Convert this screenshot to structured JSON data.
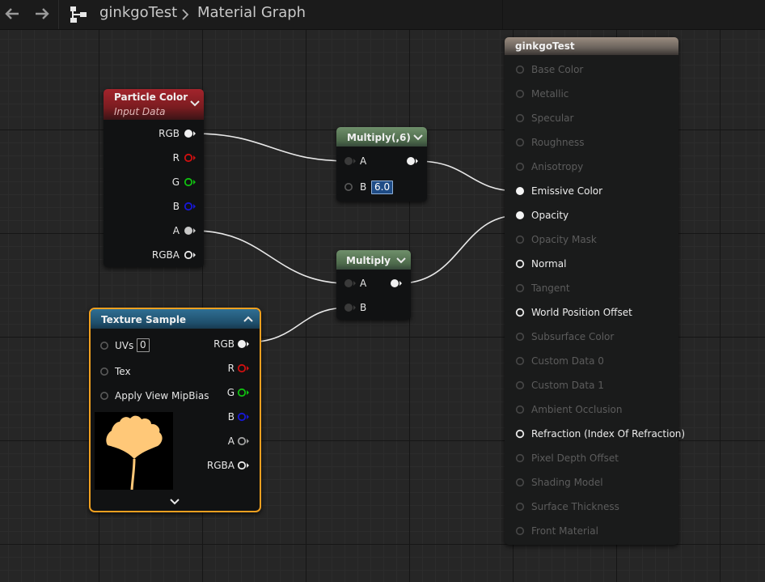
{
  "toolbar": {
    "back_icon": "arrow-left-icon",
    "forward_icon": "arrow-right-icon",
    "hierarchy_icon": "hierarchy-icon",
    "breadcrumb": [
      "ginkgoTest",
      "Material Graph"
    ]
  },
  "nodes": {
    "particle_color": {
      "title": "Particle Color",
      "subtitle": "Input Data",
      "pins": [
        "RGB",
        "R",
        "G",
        "B",
        "A",
        "RGBA"
      ]
    },
    "multiply6": {
      "title": "Multiply(,6)",
      "pin_a": "A",
      "pin_b": "B",
      "b_value": "6.0"
    },
    "multiply": {
      "title": "Multiply",
      "pin_a": "A",
      "pin_b": "B"
    },
    "texture_sample": {
      "title": "Texture Sample",
      "inputs": [
        "UVs",
        "Tex",
        "Apply View MipBias"
      ],
      "uvs_value": "0",
      "outputs": [
        "RGB",
        "R",
        "G",
        "B",
        "A",
        "RGBA"
      ]
    },
    "result": {
      "title": "ginkgoTest",
      "pins": [
        {
          "label": "Base Color",
          "active": false
        },
        {
          "label": "Metallic",
          "active": false
        },
        {
          "label": "Specular",
          "active": false
        },
        {
          "label": "Roughness",
          "active": false
        },
        {
          "label": "Anisotropy",
          "active": false
        },
        {
          "label": "Emissive Color",
          "active": true,
          "connected": true
        },
        {
          "label": "Opacity",
          "active": true,
          "connected": true
        },
        {
          "label": "Opacity Mask",
          "active": false
        },
        {
          "label": "Normal",
          "active": true,
          "connected": false
        },
        {
          "label": "Tangent",
          "active": false
        },
        {
          "label": "World Position Offset",
          "active": true,
          "connected": false
        },
        {
          "label": "Subsurface Color",
          "active": false
        },
        {
          "label": "Custom Data 0",
          "active": false
        },
        {
          "label": "Custom Data 1",
          "active": false
        },
        {
          "label": "Ambient Occlusion",
          "active": false
        },
        {
          "label": "Refraction (Index Of Refraction)",
          "active": true,
          "connected": false
        },
        {
          "label": "Pixel Depth Offset",
          "active": false
        },
        {
          "label": "Shading Model",
          "active": false
        },
        {
          "label": "Surface Thickness",
          "active": false
        },
        {
          "label": "Front Material",
          "active": false
        }
      ]
    }
  },
  "colors": {
    "selected_outline": "#f0a020",
    "pin_red": "#d01010",
    "pin_green": "#10c010",
    "pin_blue": "#1010d0",
    "texture_leaf": "#ffc878"
  }
}
